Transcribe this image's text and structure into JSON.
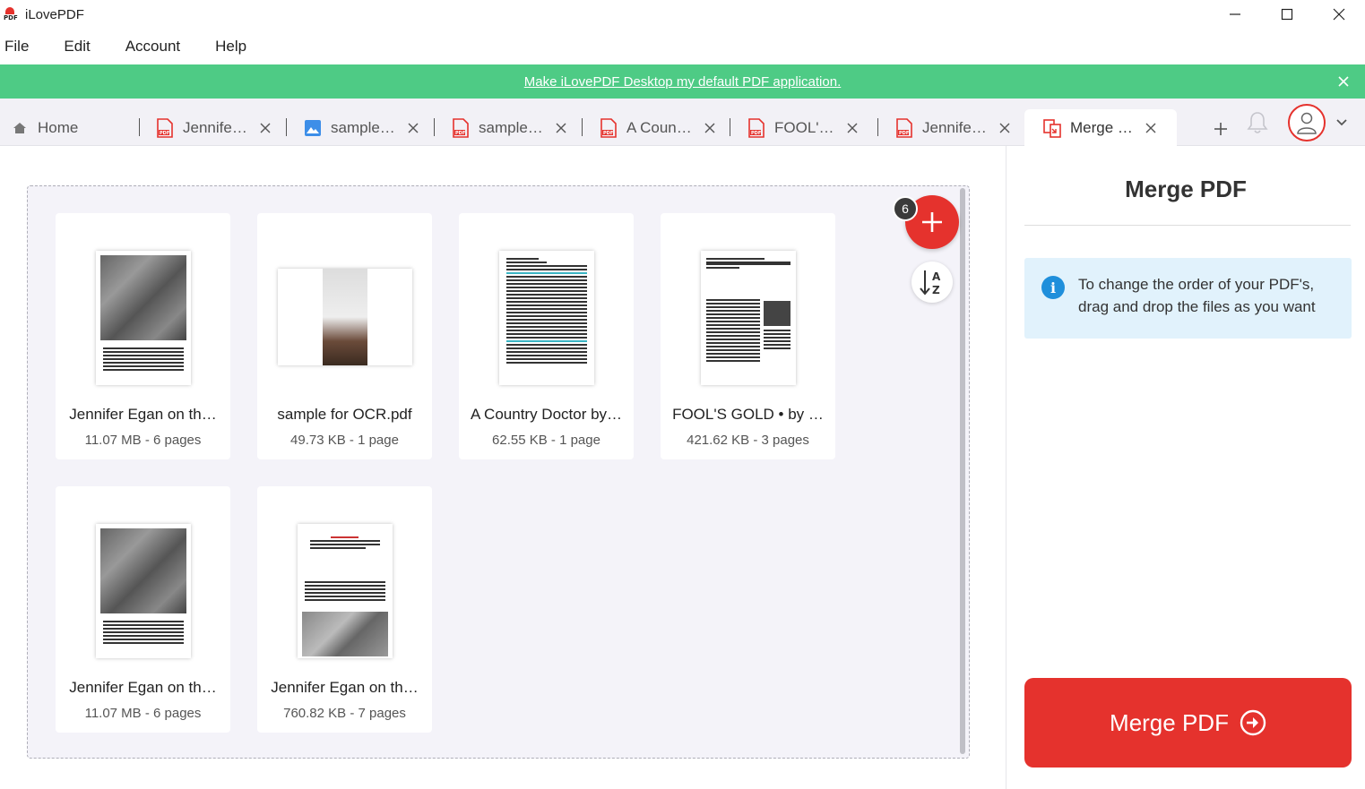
{
  "window": {
    "title": "iLovePDF",
    "logo_text": "PDF"
  },
  "menu": [
    "File",
    "Edit",
    "Account",
    "Help"
  ],
  "banner": {
    "text": "Make iLovePDF Desktop my default PDF application."
  },
  "tabs": [
    {
      "label": "Home",
      "icon": "home-icon"
    },
    {
      "label": "Jennife…",
      "icon": "pdf-file-icon"
    },
    {
      "label": "sample…",
      "icon": "image-file-icon"
    },
    {
      "label": "sample…",
      "icon": "pdf-file-icon"
    },
    {
      "label": "A Coun…",
      "icon": "pdf-file-icon"
    },
    {
      "label": "FOOL'…",
      "icon": "pdf-file-icon"
    },
    {
      "label": "Jennife…",
      "icon": "pdf-file-icon"
    },
    {
      "label": "Merge …",
      "icon": "merge-pdf-icon",
      "active": true
    }
  ],
  "files": [
    {
      "name": "Jennifer Egan on th…",
      "meta": "11.07 MB - 6 pages"
    },
    {
      "name": "sample for OCR.pdf",
      "meta": "49.73 KB - 1 page"
    },
    {
      "name": "A Country Doctor by…",
      "meta": "62.55 KB - 1 page"
    },
    {
      "name": "FOOL'S GOLD • by …",
      "meta": "421.62 KB - 3 pages"
    },
    {
      "name": "Jennifer Egan on th…",
      "meta": "11.07 MB - 6 pages"
    },
    {
      "name": "Jennifer Egan on th…",
      "meta": "760.82 KB - 7 pages"
    }
  ],
  "add_badge_count": "6",
  "panel": {
    "title": "Merge PDF",
    "info": "To change the order of your PDF's, drag and drop the files as you want",
    "merge_button": "Merge PDF"
  },
  "colors": {
    "brand_red": "#e5322d",
    "banner_green": "#4ecb85",
    "info_blue": "#1f8fdb",
    "info_bg": "#e1f2fc"
  }
}
